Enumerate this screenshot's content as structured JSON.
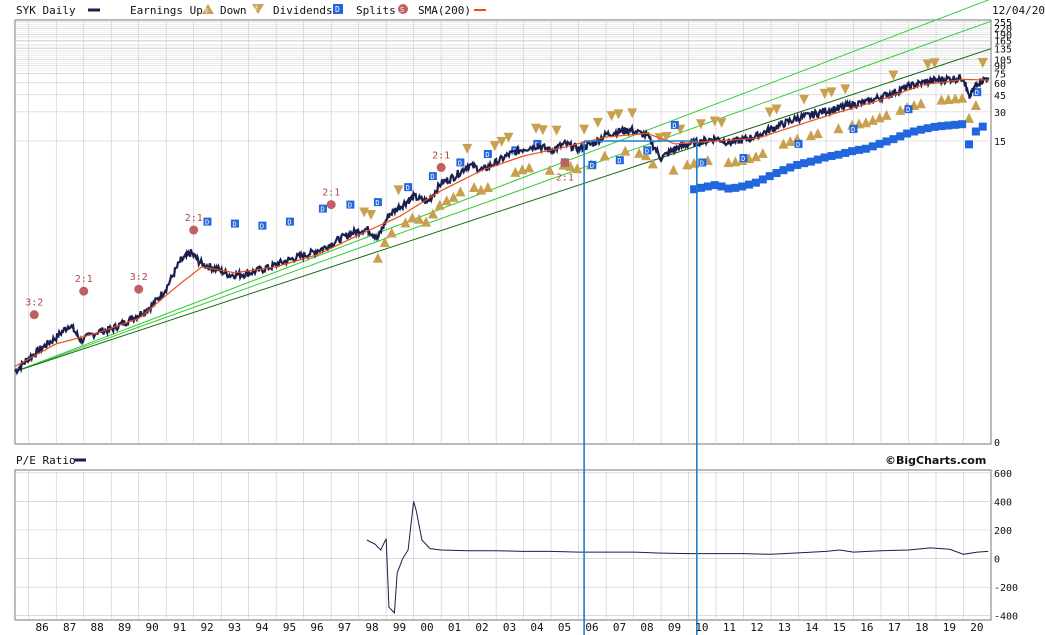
{
  "header": {
    "symbol_label": "SYK Daily",
    "legend_earnings": "Earnings Up",
    "legend_down": "Down",
    "legend_dividends": "Dividends",
    "legend_splits": "Splits",
    "legend_sma": "SMA(200)",
    "date": "12/04/20",
    "watermark": "©BigCharts.com"
  },
  "colors": {
    "price": "#1a1f4d",
    "sma": "#e8501a",
    "earnings": "#c8a050",
    "dividend": "#2266dd",
    "split": "#c06060",
    "trend_light": "#33cc33",
    "trend_dark": "#116611",
    "annotation": "#1a7fd4",
    "grid": "#c8c8c8"
  },
  "icons": {
    "earnings_up": "triangle-up-icon",
    "earnings_down": "triangle-down-icon",
    "dividend": "dividend-square-icon",
    "split": "split-circle-icon"
  },
  "price_axis": {
    "scale": "log",
    "tick_labels": [
      "255",
      "220",
      "190",
      "165",
      "135",
      "105",
      "90",
      "75",
      "60",
      "45",
      "30",
      "15",
      "0"
    ],
    "tick_values": [
      255,
      220,
      190,
      165,
      135,
      105,
      90,
      75,
      60,
      45,
      30,
      15,
      0
    ]
  },
  "pe_axis": {
    "tick_labels": [
      "600",
      "400",
      "200",
      "0",
      "-200",
      "-400"
    ],
    "tick_values": [
      600,
      400,
      200,
      0,
      -200,
      -400
    ]
  },
  "x_axis": {
    "tick_labels": [
      "86",
      "87",
      "88",
      "89",
      "90",
      "91",
      "92",
      "93",
      "94",
      "95",
      "96",
      "97",
      "98",
      "99",
      "00",
      "01",
      "02",
      "03",
      "04",
      "05",
      "06",
      "07",
      "08",
      "09",
      "10",
      "11",
      "12",
      "13",
      "14",
      "15",
      "16",
      "17",
      "18",
      "19",
      "20"
    ],
    "start_year": 1985.5,
    "end_year": 2021
  },
  "chart_data": [
    {
      "type": "line",
      "title": "SYK Daily",
      "series": [
        {
          "name": "SYK Daily",
          "x": [
            1985.5,
            1986.0,
            1986.5,
            1987.0,
            1987.5,
            1987.9,
            1988.5,
            1989.0,
            1989.5,
            1990.0,
            1990.5,
            1991.0,
            1991.5,
            1991.9,
            1992.3,
            1992.8,
            1993.3,
            1993.8,
            1994.3,
            1994.8,
            1995.3,
            1995.8,
            1996.3,
            1996.8,
            1997.3,
            1997.8,
            1998.3,
            1998.7,
            1999.1,
            1999.6,
            2000.0,
            2000.5,
            2001.0,
            2001.5,
            2002.0,
            2002.5,
            2003.0,
            2003.5,
            2004.0,
            2004.5,
            2005.0,
            2005.5,
            2006.0,
            2006.5,
            2007.0,
            2007.5,
            2007.9,
            2008.5,
            2009.0,
            2009.5,
            2010.0,
            2010.5,
            2011.0,
            2011.5,
            2012.0,
            2012.5,
            2013.0,
            2013.5,
            2014.0,
            2014.5,
            2015.0,
            2015.5,
            2016.0,
            2016.5,
            2017.0,
            2017.5,
            2018.0,
            2018.5,
            2019.0,
            2019.5,
            2020.0,
            2020.2,
            2020.5,
            2020.9
          ],
          "values": [
            0.062,
            0.085,
            0.11,
            0.14,
            0.19,
            0.13,
            0.16,
            0.17,
            0.2,
            0.24,
            0.3,
            0.45,
            0.85,
            1.05,
            0.8,
            0.72,
            0.62,
            0.63,
            0.68,
            0.75,
            0.85,
            0.95,
            1.05,
            1.2,
            1.45,
            1.7,
            1.85,
            1.5,
            2.6,
            3.3,
            4.0,
            3.5,
            5.5,
            6.5,
            8.5,
            7.5,
            9.0,
            11,
            12.5,
            13.5,
            12.0,
            14.0,
            12.5,
            14.0,
            17.5,
            19,
            19.5,
            17,
            10,
            12.5,
            14,
            15,
            16,
            14.5,
            15.5,
            17,
            20,
            23,
            26,
            28,
            31,
            33,
            36,
            38,
            43,
            48,
            55,
            60,
            64,
            66,
            68,
            42,
            60,
            68
          ],
          "unit": "USD"
        },
        {
          "name": "SMA(200)",
          "x": [
            1985.5,
            1987.0,
            1988.5,
            1990.0,
            1991.5,
            1992.3,
            1993.5,
            1995.0,
            1996.5,
            1998.0,
            1999.5,
            2001.0,
            2002.5,
            2004.0,
            2005.5,
            2007.0,
            2008.5,
            2009.5,
            2011.0,
            2012.5,
            2014.0,
            2015.5,
            2017.0,
            2018.5,
            2020.0,
            2020.9
          ],
          "values": [
            0.07,
            0.12,
            0.155,
            0.22,
            0.5,
            0.75,
            0.65,
            0.75,
            1.0,
            1.6,
            2.5,
            4.6,
            7.5,
            10.5,
            13,
            16.5,
            18,
            14,
            15,
            16,
            22,
            30,
            40,
            57,
            65,
            64
          ]
        }
      ],
      "split_annotations": [
        {
          "label": "3:2",
          "year": 1986.2,
          "price": 0.24
        },
        {
          "label": "2:1",
          "year": 1988.0,
          "price": 0.42
        },
        {
          "label": "3:2",
          "year": 1990.0,
          "price": 0.44
        },
        {
          "label": "2:1",
          "year": 1992.0,
          "price": 1.8
        },
        {
          "label": "2:1",
          "year": 1997.0,
          "price": 3.3
        },
        {
          "label": "2:1",
          "year": 2001.0,
          "price": 8.0
        },
        {
          "label": "2:1",
          "year": 2005.5,
          "price": 9.0
        }
      ],
      "dividend_markers": [
        {
          "year": 1992.5,
          "price": 2.2
        },
        {
          "year": 1993.5,
          "price": 2.1
        },
        {
          "year": 1994.5,
          "price": 2.0
        },
        {
          "year": 1995.5,
          "price": 2.2
        },
        {
          "year": 1996.7,
          "price": 3.0
        },
        {
          "year": 1997.7,
          "price": 3.3
        },
        {
          "year": 1998.7,
          "price": 3.5
        },
        {
          "year": 1999.8,
          "price": 5.0
        },
        {
          "year": 2000.7,
          "price": 6.5
        },
        {
          "year": 2001.7,
          "price": 9.0
        },
        {
          "year": 2002.7,
          "price": 11
        },
        {
          "year": 2003.7,
          "price": 12
        },
        {
          "year": 2004.5,
          "price": 14
        },
        {
          "year": 2005.5,
          "price": 9.0
        },
        {
          "year": 2006.5,
          "price": 8.5
        },
        {
          "year": 2007.5,
          "price": 9.5
        },
        {
          "year": 2008.5,
          "price": 12
        },
        {
          "year": 2009.5,
          "price": 22
        },
        {
          "year": 2010.5,
          "price": 9.0
        },
        {
          "year": 2012.0,
          "price": 10
        },
        {
          "year": 2014.0,
          "price": 14
        },
        {
          "year": 2016.0,
          "price": 20
        },
        {
          "year": 2018.0,
          "price": 32
        },
        {
          "year": 2020.5,
          "price": 48
        }
      ],
      "earnings_markers_summary": {
        "start_year": 1998.2,
        "end_year": 2021,
        "note": "quarterly earnings up/down triangles"
      }
    },
    {
      "type": "line",
      "title": "P/E Ratio",
      "series": [
        {
          "name": "P/E Ratio",
          "x": [
            1998.3,
            1998.6,
            1998.8,
            1999.0,
            1999.1,
            1999.3,
            1999.4,
            1999.6,
            1999.8,
            2000.0,
            2000.1,
            2000.3,
            2000.6,
            2001.0,
            2002.0,
            2003.0,
            2004.0,
            2005.0,
            2006.0,
            2007.0,
            2008.0,
            2009.0,
            2010.0,
            2011.0,
            2012.0,
            2013.0,
            2014.0,
            2015.0,
            2015.5,
            2016.0,
            2017.0,
            2018.0,
            2018.8,
            2019.5,
            2020.0,
            2020.5,
            2020.9
          ],
          "values": [
            130,
            100,
            60,
            140,
            -340,
            -380,
            -100,
            0,
            60,
            400,
            330,
            130,
            70,
            60,
            55,
            55,
            50,
            50,
            45,
            45,
            45,
            38,
            35,
            35,
            35,
            30,
            40,
            50,
            60,
            45,
            55,
            60,
            75,
            65,
            30,
            45,
            50
          ]
        }
      ],
      "ylim": [
        -430,
        620
      ]
    }
  ],
  "annotations": {
    "vertical_lines_year": [
      2006.2,
      2010.3
    ],
    "horizontal_segment": {
      "from_year": 2006.2,
      "to_year": 2010.3,
      "price": 15
    }
  }
}
